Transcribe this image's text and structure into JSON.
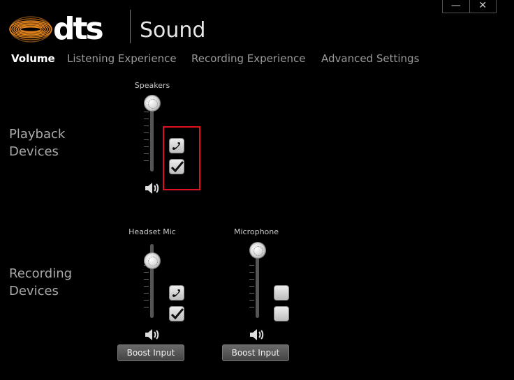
{
  "header": {
    "brand": "dts",
    "product": "Sound",
    "window_controls": {
      "minimize": "—",
      "close": "✕"
    }
  },
  "tabs": [
    {
      "label": "Volume",
      "active": true
    },
    {
      "label": "Listening Experience",
      "active": false
    },
    {
      "label": "Recording Experience",
      "active": false
    },
    {
      "label": "Advanced Settings",
      "active": false
    }
  ],
  "playback": {
    "section_label": [
      "Playback",
      "Devices"
    ],
    "devices": [
      {
        "name": "Speakers",
        "volume_level": 1.0,
        "comm_default": true,
        "default": true
      }
    ]
  },
  "recording": {
    "section_label": [
      "Recording",
      "Devices"
    ],
    "devices": [
      {
        "name": "Headset Mic",
        "volume_level": 0.85,
        "comm_default": true,
        "default": true,
        "boost_label": "Boost Input"
      },
      {
        "name": "Microphone",
        "volume_level": 1.0,
        "comm_default": false,
        "default": false,
        "boost_label": "Boost Input"
      }
    ]
  },
  "colors": {
    "background": "#000000",
    "logo_orange": "#e8871e",
    "highlight": "#e0101e"
  },
  "icons": [
    "dts-logo-icon",
    "speaker-volume-icon",
    "phone-icon",
    "checkmark-icon"
  ]
}
